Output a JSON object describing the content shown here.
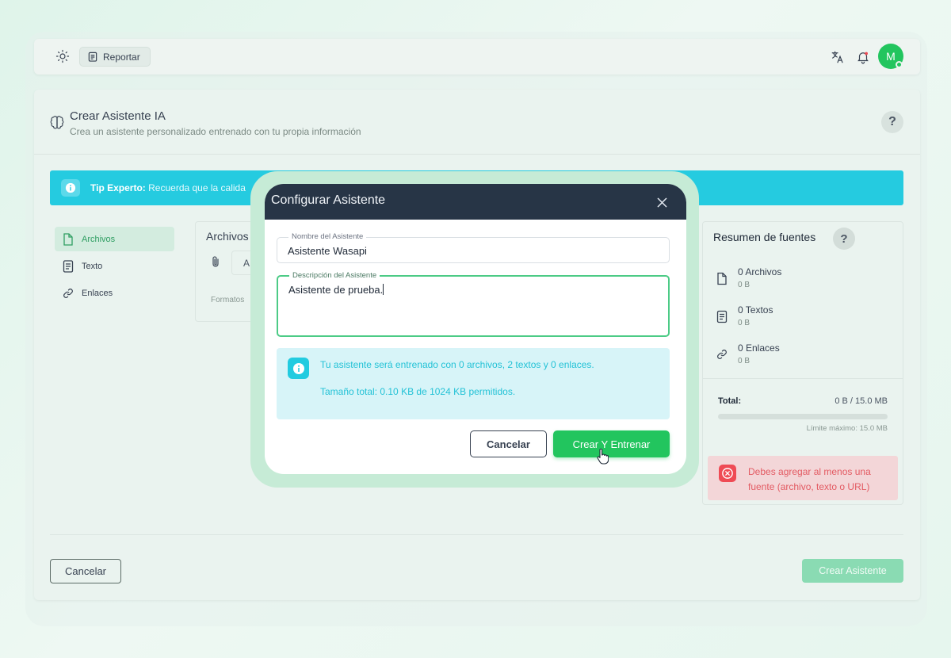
{
  "topbar": {
    "report_label": "Reportar",
    "avatar_initial": "M"
  },
  "page": {
    "title": "Crear Asistente IA",
    "subtitle": "Crea un asistente personalizado entrenado con tu propia información"
  },
  "tip": {
    "label": "Tip Experto:",
    "text": "Recuerda que la calida"
  },
  "sidebar": {
    "items": [
      {
        "label": "Archivos",
        "icon": "file-icon",
        "active": true
      },
      {
        "label": "Texto",
        "icon": "text-document-icon",
        "active": false
      },
      {
        "label": "Enlaces",
        "icon": "link-icon",
        "active": false
      }
    ]
  },
  "files_panel": {
    "title": "Archivos",
    "input_text": "A",
    "formats_text": "Formatos"
  },
  "summary": {
    "title": "Resumen de fuentes",
    "items": [
      {
        "label": "0 Archivos",
        "size": "0 B",
        "icon": "file-icon"
      },
      {
        "label": "0 Textos",
        "size": "0 B",
        "icon": "text-document-icon"
      },
      {
        "label": "0 Enlaces",
        "size": "0 B",
        "icon": "link-icon"
      }
    ],
    "total_label": "Total:",
    "total_value": "0 B / 15.0 MB",
    "progress_fraction": 0,
    "limit_text": "Límite máximo: 15.0 MB",
    "error_text": "Debes agregar al menos una fuente (archivo, texto o URL)"
  },
  "footer": {
    "cancel_label": "Cancelar",
    "create_label": "Crear Asistente"
  },
  "modal": {
    "title": "Configurar Asistente",
    "name_label": "Nombre del Asistente",
    "name_value": "Asistente Wasapi",
    "description_label": "Descripción del Asistente",
    "description_value": "Asistente de prueba.",
    "info_line1": "Tu asistente será entrenado con 0 archivos, 2 textos y 0 enlaces.",
    "info_line2": "Tamaño total: 0.10 KB de 1024 KB permitidos.",
    "cancel_label": "Cancelar",
    "create_label": "Crear Y Entrenar"
  },
  "colors": {
    "accent": "#22c55e",
    "header_dark": "#273546",
    "info_cyan": "#22cbe0",
    "error_red": "#ef4b55"
  }
}
